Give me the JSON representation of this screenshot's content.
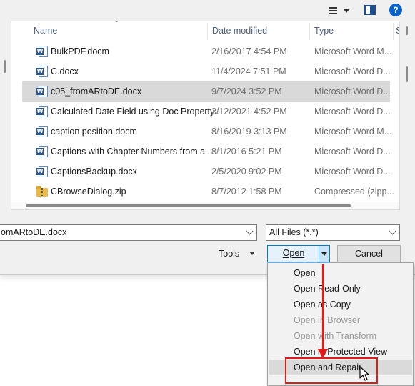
{
  "toolbar": {
    "view_icon": "view-menu-icon",
    "preview_icon": "preview-pane-icon",
    "help_label": "?"
  },
  "columns": {
    "name": "Name",
    "date": "Date modified",
    "type": "Type",
    "size": "S"
  },
  "files": [
    {
      "name": "BulkPDF.docm",
      "date": "2/16/2017 4:54 PM",
      "type": "Microsoft Word M...",
      "icon": "word-icon"
    },
    {
      "name": "C.docx",
      "date": "11/4/2024 7:51 PM",
      "type": "Microsoft Word D...",
      "icon": "word-icon"
    },
    {
      "name": "c05_fromARtoDE.docx",
      "date": "9/7/2024 3:52 PM",
      "type": "Microsoft Word D...",
      "icon": "word-icon",
      "selected": true
    },
    {
      "name": "Calculated Date Field using Doc Property...",
      "date": "3/12/2021 4:52 PM",
      "type": "Microsoft Word D...",
      "icon": "word-icon"
    },
    {
      "name": "caption position.docm",
      "date": "8/16/2019 3:13 PM",
      "type": "Microsoft Word M...",
      "icon": "word-icon"
    },
    {
      "name": "Captions with Chapter Numbers from a ...",
      "date": "8/1/2016 5:21 PM",
      "type": "Microsoft Word D...",
      "icon": "word-icon"
    },
    {
      "name": "CaptionsBackup.docx",
      "date": "2/5/2020 9:02 PM",
      "type": "Microsoft Word D...",
      "icon": "word-icon"
    },
    {
      "name": "CBrowseDialog.zip",
      "date": "8/7/2012 1:58 PM",
      "type": "Compressed (zipp...",
      "icon": "zip-icon"
    }
  ],
  "filename_field": {
    "value": "omARtoDE.docx"
  },
  "filter_field": {
    "value": "All Files (*.*)"
  },
  "tools_label": "Tools",
  "open_label": "Open",
  "cancel_label": "Cancel",
  "open_menu": [
    {
      "label": "Open",
      "enabled": true
    },
    {
      "label": "Open Read-Only",
      "enabled": true
    },
    {
      "label": "Open as Copy",
      "enabled": true
    },
    {
      "label": "Open in Browser",
      "enabled": false
    },
    {
      "label": "Open with Transform",
      "enabled": false
    },
    {
      "label": "Open in Protected View",
      "enabled": true
    },
    {
      "label": "Open and Repair",
      "enabled": true,
      "highlighted": true
    }
  ],
  "annotation": {
    "color": "#e01b1b"
  }
}
